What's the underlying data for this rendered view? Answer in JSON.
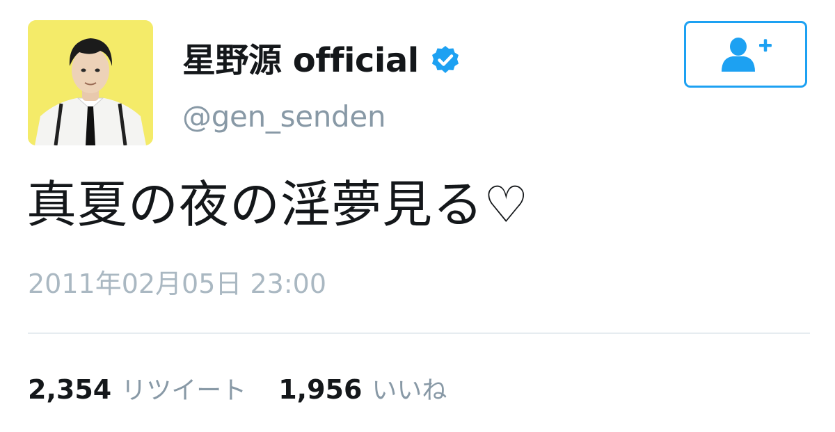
{
  "user": {
    "display_name": "星野源 official",
    "handle": "@gen_senden",
    "verified": true,
    "avatar_background": "#f3ea5d"
  },
  "follow_button": {
    "icon": "follow-user-plus-icon",
    "color": "#1da1f2"
  },
  "tweet": {
    "text": "真夏の夜の淫夢見る♡",
    "timestamp": "2011年02月05日 23:00"
  },
  "stats": {
    "retweets": {
      "count": "2,354",
      "label": "リツイート"
    },
    "likes": {
      "count": "1,956",
      "label": "いいね"
    }
  },
  "colors": {
    "text_primary": "#14171a",
    "text_secondary": "#8899a6",
    "timestamp": "#aab8c2",
    "accent": "#1da1f2",
    "divider": "#e6ecf0"
  }
}
